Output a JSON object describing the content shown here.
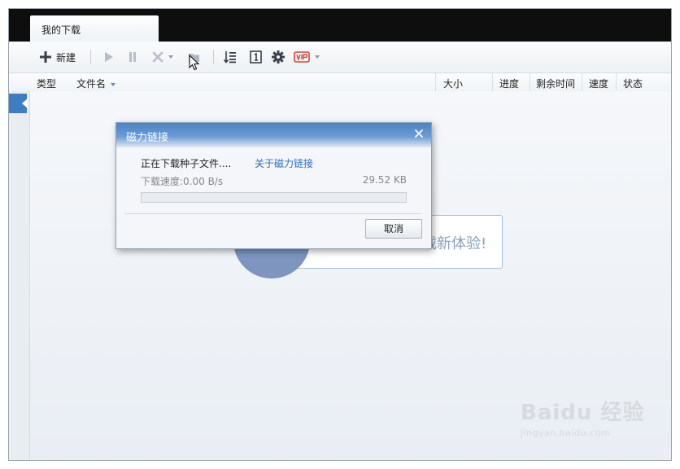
{
  "window": {
    "tab_title": "我的下载"
  },
  "toolbar": {
    "new_label": "新建",
    "icons": [
      "plus-icon",
      "play-icon",
      "pause-icon",
      "delete-icon",
      "folder-icon",
      "sort-icon",
      "single-task-icon",
      "gear-icon",
      "vip-icon"
    ]
  },
  "columns": {
    "type": "类型",
    "filename": "文件名",
    "size": "大小",
    "progress": "进度",
    "remaining": "剩余时间",
    "speed": "速度",
    "status": "状态"
  },
  "promo": {
    "text": "载新体验!"
  },
  "dialog": {
    "title": "磁力链接",
    "status_text": "正在下载种子文件....",
    "link_text": "关于磁力链接",
    "speed_text": "下载速度:0.00 B/s",
    "size_text": "29.52 KB",
    "progress": 0,
    "cancel_label": "取消"
  },
  "watermark": {
    "main": "Baidu 经验",
    "sub": "jingyan.baidu.com"
  },
  "colors": {
    "accent": "#3d7ec3",
    "dialog_title_bg": "#4d82c4",
    "link": "#2b6cc1",
    "vip": "#d9453a"
  }
}
